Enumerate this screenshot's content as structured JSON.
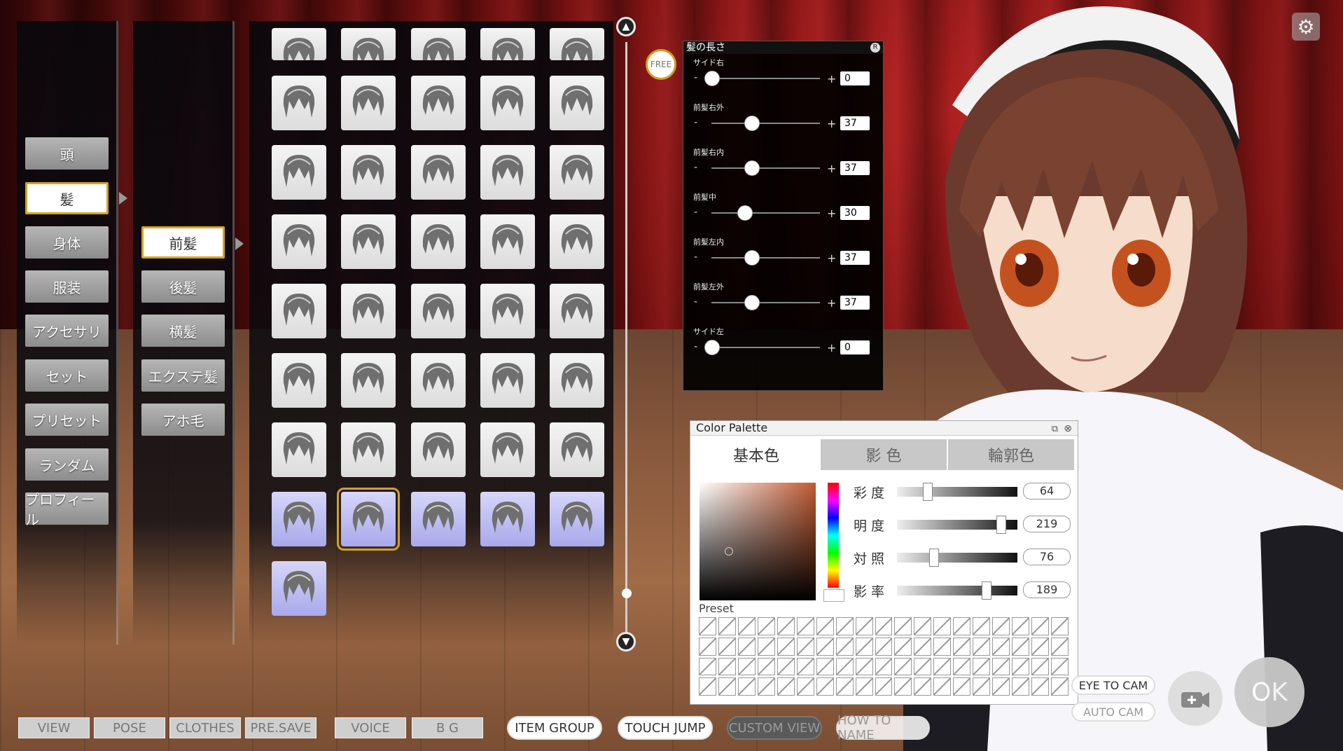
{
  "categories": [
    "頭",
    "髪",
    "身体",
    "服装",
    "アクセサリ",
    "セット",
    "プリセット",
    "ランダム",
    "プロフィール"
  ],
  "selected_category": "髪",
  "hair_parts": [
    "前髪",
    "後髪",
    "横髪",
    "エクステ髪",
    "アホ毛"
  ],
  "selected_hair_part": "前髪",
  "free_label": "FREE",
  "length_panel": {
    "title": "髪の長さ",
    "close_label": "R",
    "sliders": [
      {
        "label": "サイド右",
        "value": "0",
        "level": 0
      },
      {
        "label": "前髪右外",
        "value": "37",
        "level": 0.37
      },
      {
        "label": "前髪右内",
        "value": "37",
        "level": 0.37
      },
      {
        "label": "前髪中",
        "value": "30",
        "level": 0.3
      },
      {
        "label": "前髪左内",
        "value": "37",
        "level": 0.37
      },
      {
        "label": "前髪左外",
        "value": "37",
        "level": 0.37
      },
      {
        "label": "サイド左",
        "value": "0",
        "level": 0
      }
    ],
    "minus": "-",
    "plus": "+"
  },
  "palette": {
    "title": "Color Palette",
    "tabs": [
      "基本色",
      "影 色",
      "輪郭色"
    ],
    "active_tab": "基本色",
    "rows": [
      {
        "label": "彩度",
        "value": "64",
        "level": 0.25
      },
      {
        "label": "明度",
        "value": "219",
        "level": 0.86
      },
      {
        "label": "対照",
        "value": "76",
        "level": 0.3
      },
      {
        "label": "影率",
        "value": "189",
        "level": 0.74
      }
    ],
    "preset_label": "Preset",
    "base_color": "#c05a33"
  },
  "bottom_bar": {
    "left_buttons": [
      "VIEW",
      "POSE",
      "CLOTHES",
      "PRE.SAVE",
      "VOICE",
      "B G"
    ],
    "pills": [
      "ITEM GROUP",
      "TOUCH JUMP",
      "CUSTOM VIEW",
      "HOW TO NAME"
    ]
  },
  "right_controls": {
    "eye_to_cam": "EYE TO CAM",
    "auto_cam": "AUTO CAM",
    "ok": "OK"
  },
  "hair_grid": {
    "rows_visible": 9,
    "selected_index": 36,
    "blue_indices": [
      35,
      36,
      37,
      38,
      39,
      40
    ]
  }
}
